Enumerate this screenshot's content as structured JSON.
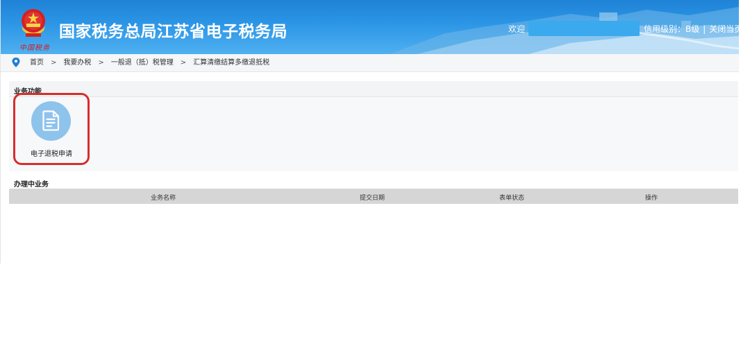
{
  "header": {
    "site_title": "国家税务总局江苏省电子税务局",
    "brand_script": "中国税务",
    "welcome_label": "欢迎",
    "credit_level": "信用级别：B级",
    "close_page": "关闭当页"
  },
  "breadcrumb": {
    "items": [
      {
        "label": "首页"
      },
      {
        "label": "我要办税"
      },
      {
        "label": "一般退（抵）税管理"
      },
      {
        "label": "汇算清缴结算多缴退抵税"
      }
    ],
    "separator": ">"
  },
  "business_functions": {
    "title": "业务功能",
    "items": [
      {
        "label": "电子退税申请",
        "icon": "document-icon"
      }
    ]
  },
  "in_progress": {
    "title": "办理中业务",
    "columns": [
      "业务名称",
      "提交日期",
      "表单状态",
      "操作"
    ],
    "rows": []
  },
  "colors": {
    "header_blue": "#2d96e6",
    "icon_circle": "#8ec3ec",
    "highlight_red": "#d82c2c",
    "table_header": "#d6d6d6"
  }
}
